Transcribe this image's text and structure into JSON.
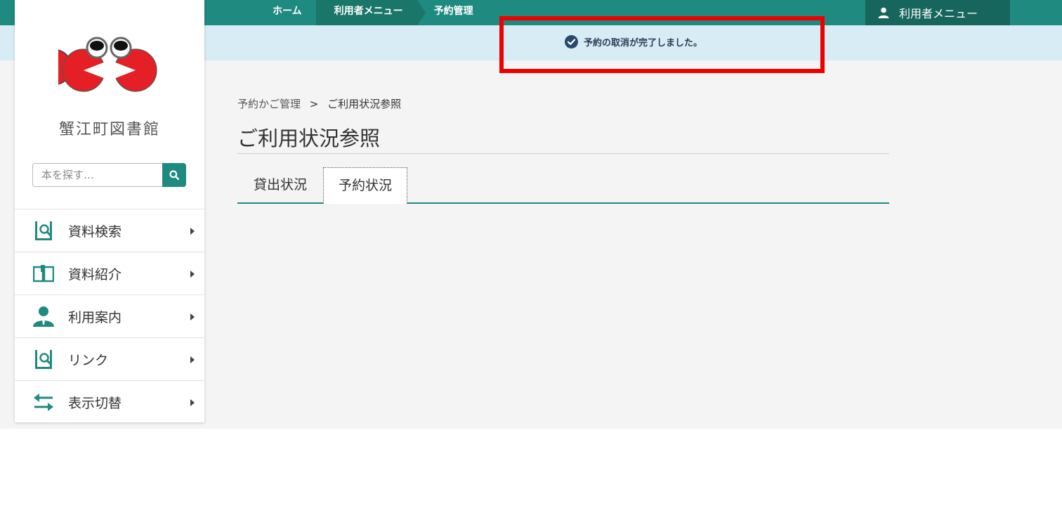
{
  "topnav": {
    "breadcrumb": [
      "ホーム",
      "利用者メニュー",
      "予約管理"
    ],
    "user_menu_label": "利用者メニュー"
  },
  "notice": {
    "message": "予約の取消が完了しました。"
  },
  "sidebar": {
    "library_name": "蟹江町図書館",
    "search_placeholder": "本を探す…",
    "items": [
      {
        "label": "資料検索",
        "icon": "book-search-icon"
      },
      {
        "label": "資料紹介",
        "icon": "open-book-icon"
      },
      {
        "label": "利用案内",
        "icon": "person-icon"
      },
      {
        "label": "リンク",
        "icon": "book-search-icon"
      },
      {
        "label": "表示切替",
        "icon": "swap-arrows-icon"
      }
    ]
  },
  "main": {
    "breadcrumb": {
      "parent": "予約かご管理",
      "separator": ">",
      "current": "ご利用状況参照"
    },
    "title": "ご利用状況参照",
    "tabs": [
      {
        "label": "貸出状況"
      },
      {
        "label": "予約状況"
      }
    ]
  },
  "colors": {
    "accent": "#1f8a80",
    "highlight": "#ee0000",
    "notice_bg": "#d8ecf5"
  }
}
